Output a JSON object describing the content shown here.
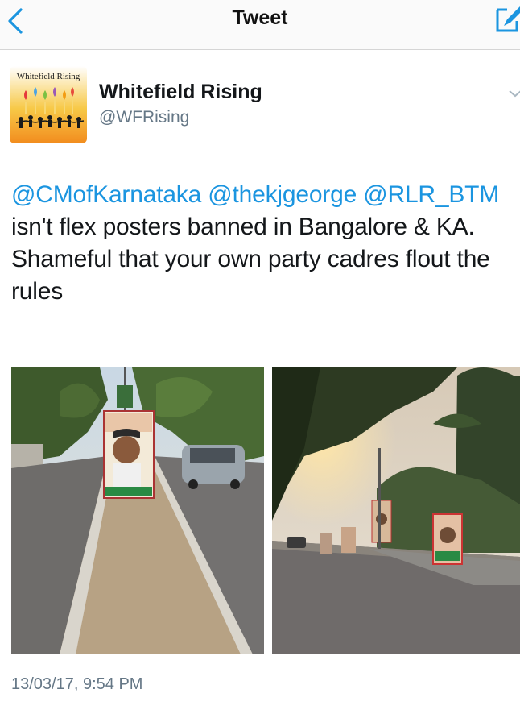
{
  "nav": {
    "title": "Tweet",
    "back_icon": "chevron-left-icon",
    "compose_icon": "compose-icon",
    "accent_color": "#1b95e0"
  },
  "author": {
    "avatar_text": "Whitefield Rising",
    "display_name": "Whitefield Rising",
    "handle": "@WFRising",
    "menu_icon": "chevron-down-icon"
  },
  "tweet": {
    "mention_1": "@CMofKarnataka",
    "mention_2": "@thekjgeorge",
    "mention_3": "@RLR_BTM",
    "text_part_1": " isn't flex posters banned in Bangalore & KA. Shameful that your own party cadres flout the rules",
    "timestamp": "13/03/17, 9:54 PM"
  },
  "media": [
    {
      "description_icon": "photo-road-poster"
    },
    {
      "description_icon": "photo-street-posters-sunset"
    }
  ]
}
